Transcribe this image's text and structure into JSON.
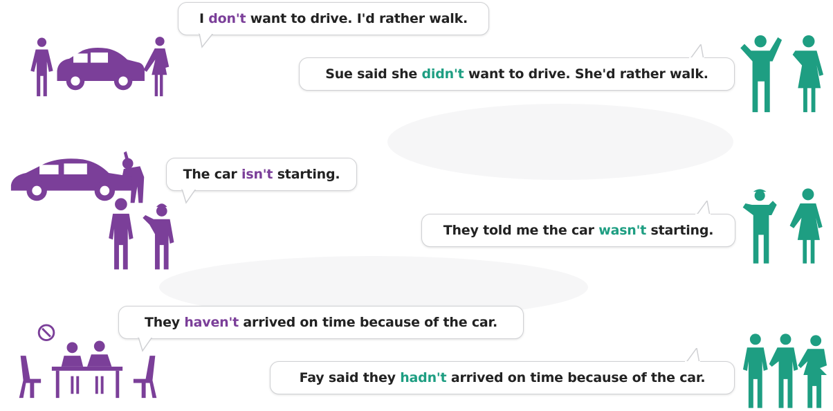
{
  "colors": {
    "direct_speech": "#7b3f99",
    "reported_speech": "#1e9e82",
    "text": "#222222",
    "bubble_border": "#cfd0d3"
  },
  "examples": [
    {
      "direct": {
        "before": "I ",
        "highlight": "don't",
        "after": " want to drive. I'd rather walk."
      },
      "reported": {
        "before": "Sue said she ",
        "highlight": "didn't",
        "after": " want to drive. She'd rather walk."
      },
      "direct_illustration_icon": "people-with-car-icon",
      "reported_illustration_icon": "two-people-talking-icon"
    },
    {
      "direct": {
        "before": "The car ",
        "highlight": "isn't",
        "after": " starting."
      },
      "reported": {
        "before": "They told me the car ",
        "highlight": "wasn't",
        "after": " starting."
      },
      "direct_illustration_icon": "mechanic-repairing-car-icon",
      "reported_illustration_icon": "two-people-talking-icon"
    },
    {
      "direct": {
        "before": "They ",
        "highlight": "haven't",
        "after": " arrived on time because of the car."
      },
      "reported": {
        "before": "Fay said they ",
        "highlight": "hadn't",
        "after": " arrived on time because of the car."
      },
      "direct_illustration_icon": "meeting-table-clock-icon",
      "reported_illustration_icon": "three-people-talking-icon"
    }
  ]
}
